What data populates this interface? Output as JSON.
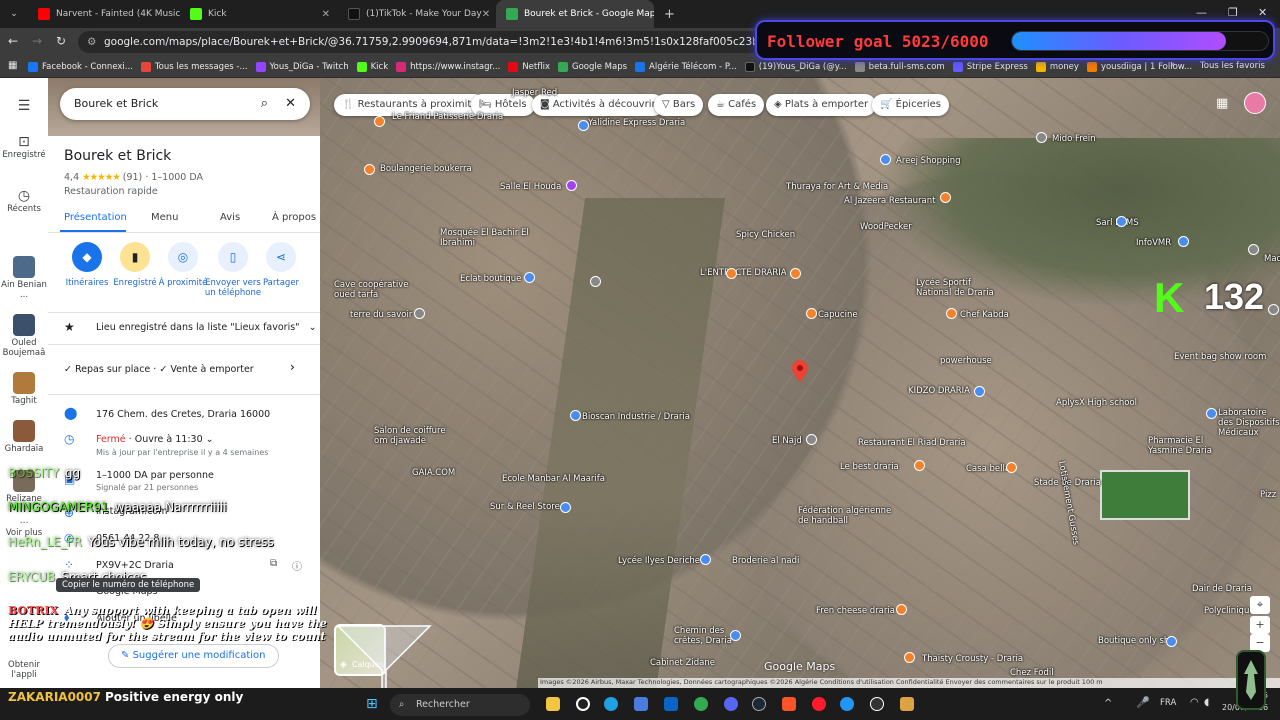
{
  "tabs": [
    {
      "title": "Narvent - Fainted (4K Music Vi",
      "color": "#ff0000"
    },
    {
      "title": "Kick",
      "color": "#53fc18"
    },
    {
      "title": "(1)TikTok - Make Your Day",
      "color": "#111111"
    },
    {
      "title": "Bourek et Brick - Google Maps",
      "color": "#34a853"
    }
  ],
  "address": {
    "url": "google.com/maps/place/Bourek+et+Brick/@36.71759,2.9909694,871m/data=!3m2!1e3!4b1!4m6!3m5!1s0x128faf005c23b1b9:0x88e5fc67eea42e61!8m2!3d36"
  },
  "bookmarks": [
    {
      "label": "Facebook - Connexi...",
      "color": "#1877f2"
    },
    {
      "label": "Tous les messages -...",
      "color": "#e8453c"
    },
    {
      "label": "Yous_DiGa - Twitch",
      "color": "#9146ff"
    },
    {
      "label": "Kick",
      "color": "#53fc18"
    },
    {
      "label": "https://www.instagr...",
      "color": "#d62976"
    },
    {
      "label": "Netflix",
      "color": "#e50914"
    },
    {
      "label": "Google Maps",
      "color": "#34a853"
    },
    {
      "label": "Algérie Télécom - P...",
      "color": "#1a73e8"
    },
    {
      "label": "(19)Yous_DiGa (@y...",
      "color": "#111111"
    },
    {
      "label": "beta.full-sms.com",
      "color": "#888888"
    },
    {
      "label": "Stripe Express",
      "color": "#635bff"
    },
    {
      "label": "money",
      "color": "#f4b400"
    },
    {
      "label": "yousdiiga | 1 Follow...",
      "color": "#f57c00"
    }
  ],
  "bookmarks_all": "Tous les favoris",
  "goal": {
    "text": "Follower goal 5023/6000",
    "progress": 0.837
  },
  "rail": {
    "saved": "Enregistré",
    "recents": "Récents",
    "recent_places": [
      "Ain Benian ...",
      "Ouled Boujemaâ",
      "Taghit",
      "Ghardaïa",
      "Relizane"
    ],
    "more": "Voir plus",
    "app": "Obtenir l'appli"
  },
  "panel": {
    "search_value": "Bourek et Brick",
    "title": "Bourek et Brick",
    "rating": "4,4",
    "reviews": "(91)",
    "price": "· 1–1000 DA",
    "category": "Restauration rapide",
    "tabs": [
      "Présentation",
      "Menu",
      "Avis",
      "À propos"
    ],
    "actions": [
      "Itinéraires",
      "Enregistré",
      "À proximité",
      "Envoyer vers un téléphone",
      "Partager"
    ],
    "saved_list": "Lieu enregistré dans la liste \"Lieux favoris\"",
    "services": "Repas sur place · ✓ Vente à emporter",
    "address": "176 Chem. des Cretes, Draria 16000",
    "hours_status": "Fermé",
    "hours_open": "· Ouvre à 11:30",
    "hours_note": "Mis à jour par l'entreprise il y a 4 semaines",
    "price_person": "1–1000 DA par personne",
    "price_note": "Signalé par 21 personnes",
    "website": "instagram.com",
    "phone": "0561 44 22 8",
    "plus_code": "PX9V+2C Draria",
    "maps_link": "Google Maps",
    "label_add": "Ajouter un libellé",
    "suggest": "Suggérer une modification",
    "tooltip": "Copier le numéro de téléphone"
  },
  "chips": [
    "Restaurants à proximité",
    "Hôtels",
    "Activités à découvrir",
    "Bars",
    "Cafés",
    "Plats à emporter",
    "Épiceries"
  ],
  "map_labels": [
    "Yalidine Express Draria",
    "Boulangerie boukerra",
    "Salle El Houda",
    "Mosquée El Bachir El Ibrahimi",
    "Eclat boutique",
    "Cave coopérative oued tarfa",
    "terre du savoir",
    "Spicy Chicken",
    "L'ENTRACTE DRARIA",
    "Thuraya for Art & Media",
    "Al Jazeera Restaurant",
    "WoodPecker",
    "Areej Shopping",
    "Mido Frein",
    "Sarl EEMS",
    "InfoVMR",
    "Lycée Sportif National de Draria",
    "Capucine",
    "Chef Kabda",
    "powerhouse",
    "KIDZO DRARIA",
    "AplysX High school",
    "Event bag show room",
    "Bioscan Industrie / Draria",
    "Salon de coiffure om djawade",
    "GAIA.COM",
    "El Najd",
    "Restaurant El Riad Draria",
    "Laboratoire des Dispositifs Médicaux",
    "Pharmacie El Yasmine Draria",
    "Le best draria",
    "Casa bella",
    "Stade de Draria",
    "Ecole Manbar Al Maarifa",
    "Sur & Reel Store",
    "Fédération algérienne de handball",
    "Lycée Ilyes Deriche",
    "Broderie al nadi",
    "Fren cheese draria",
    "Chemin des crêtes, Draria",
    "Cabinet Zidane",
    "Boutique only she",
    "Thaisty Crousty - Draria",
    "Chez Fodil",
    "Dair de Draria",
    "Polyclinique",
    "Madr",
    "Pizz",
    "Jasper Red",
    "Le Friand Pâtisserie Draria",
    "Lotissement Gusses"
  ],
  "map_logo": "Google Maps",
  "map_layers": "Calques",
  "attribution": "Images ©2026 Airbus, Maxar Technologies, Données cartographiques ©2026   Algérie   Conditions d'utilisation   Confidentialité   Envoyer des commentaires sur le produit   100 m",
  "kick_viewers": "132",
  "chat": [
    {
      "user": "BOSSITY",
      "text": "gg"
    },
    {
      "user": "MINGOGAMER91",
      "text": "waaaaa Narrrrrriiiii"
    },
    {
      "user": "HeRn_LE_FR",
      "text": "Yous vibe mlih today, no stress"
    },
    {
      "user": "ERYCUB",
      "text": "Smart choices"
    },
    {
      "user": "BOTRIX",
      "text": "Any support with keeping a tab open will HELP tremendously! 😍 Simply ensure you have the audio unmuted for the stream for the view to count"
    }
  ],
  "last_chat": {
    "user": "ZAKARIA0007",
    "text": "Positive energy only"
  },
  "taskbar": {
    "search": "Rechercher",
    "lang": "FRA",
    "time": "20:15",
    "date": "20/01/2026"
  }
}
